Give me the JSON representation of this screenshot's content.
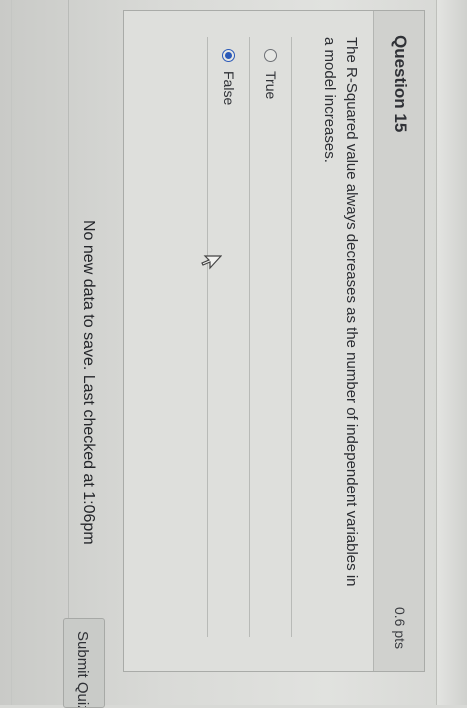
{
  "question": {
    "title": "Question 15",
    "points": "0.6 pts",
    "text": "The R-Squared value always decreases as the number of independent variables in a model increases.",
    "options": [
      {
        "label": "True",
        "selected": false
      },
      {
        "label": "False",
        "selected": true
      }
    ]
  },
  "status": {
    "message": "No new data to save. Last checked at 1:06pm"
  },
  "actions": {
    "submit_label": "Submit Quiz"
  },
  "colors": {
    "accent": "#2a59b8",
    "background": "#d8d9d6"
  },
  "icons": {
    "cursor": "cursor-arrow-icon"
  }
}
